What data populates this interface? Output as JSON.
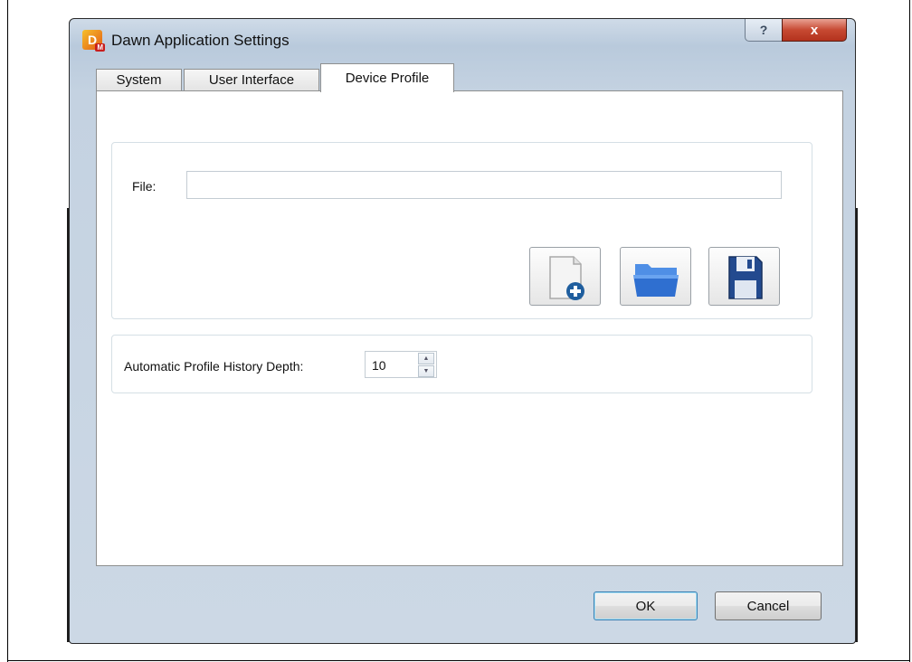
{
  "window": {
    "title": "Dawn Application Settings"
  },
  "titlebar": {
    "help_label": "?",
    "close_label": "x"
  },
  "tabs": [
    {
      "label": "System",
      "active": false
    },
    {
      "label": "User Interface",
      "active": false
    },
    {
      "label": "Device Profile",
      "active": true
    }
  ],
  "device_profile": {
    "file_label": "File:",
    "file_value": "",
    "buttons": [
      {
        "icon": "new-document-icon"
      },
      {
        "icon": "open-folder-icon"
      },
      {
        "icon": "save-floppy-icon"
      }
    ],
    "history_label": "Automatic Profile History Depth:",
    "history_value": "10"
  },
  "dialog_buttons": {
    "ok_label": "OK",
    "cancel_label": "Cancel"
  },
  "colors": {
    "close_button": "#c74a33",
    "folder_blue": "#2f6fd0",
    "floppy_blue": "#234a8f",
    "add_badge": "#1f5e9e"
  }
}
